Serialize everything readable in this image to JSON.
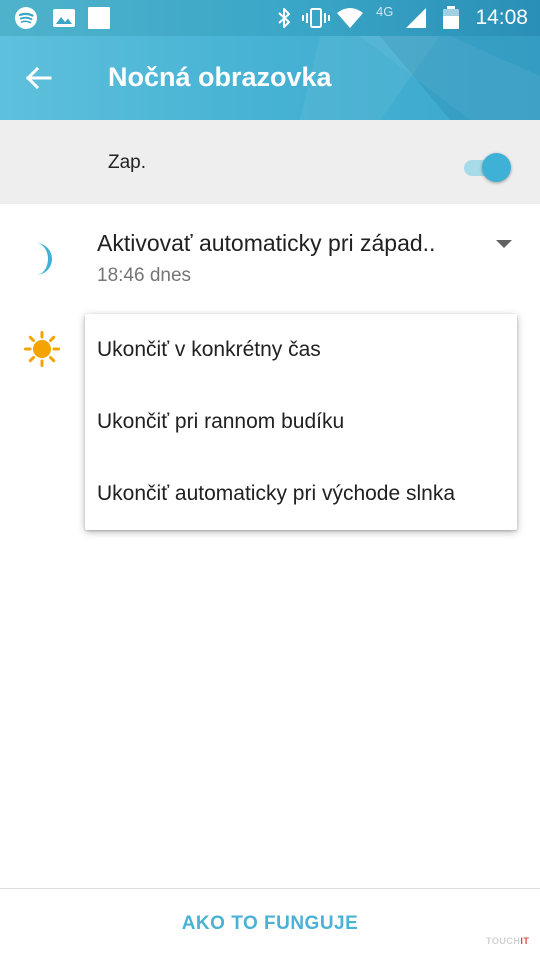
{
  "status_bar": {
    "time": "14:08",
    "network": "4G",
    "left_icons": [
      "spotify-icon",
      "gallery-icon",
      "blank-notification-icon"
    ],
    "right_icons": [
      "bluetooth-icon",
      "vibrate-icon",
      "wifi-icon",
      "cell-signal-icon",
      "battery-icon"
    ]
  },
  "app_bar": {
    "title": "Nočná obrazovka",
    "back_icon": "arrow-left-icon"
  },
  "master_switch": {
    "label": "Zap.",
    "enabled": true
  },
  "schedule": {
    "title": "Aktivovať automaticky pri západ..",
    "subtitle": "18:46 dnes",
    "icon": "moon-icon"
  },
  "end_icon": "sun-icon",
  "dropdown": {
    "options": [
      {
        "label": "Ukončiť v konkrétny čas"
      },
      {
        "label": "Ukončiť pri rannom budíku"
      },
      {
        "label": "Ukončiť automaticky pri východe slnka"
      }
    ]
  },
  "footer": {
    "button_label": "AKO TO FUNGUJE"
  },
  "watermark": {
    "prefix": "TOUCH",
    "suffix": "IT"
  },
  "colors": {
    "accent": "#4bb2d6",
    "app_bar": "#48b3d4",
    "toggle_thumb": "#3fb0d6",
    "moon": "#3fb0d6",
    "sun": "#f5a300"
  }
}
